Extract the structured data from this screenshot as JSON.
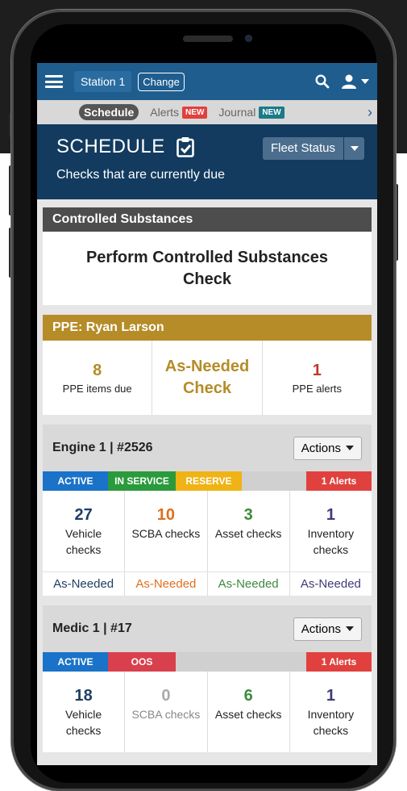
{
  "colors": {
    "nav_blue": "#1f5d8f",
    "hero_navy": "#123b5f",
    "ppe_gold": "#b58c28",
    "active_blue": "#1a73c9",
    "in_service_green": "#2a9a3c",
    "reserve_yellow": "#f0b316",
    "oos_red": "#d9404d",
    "alert_red": "#e0413e",
    "count_navy": "#1e3f66",
    "scba_orange": "#e06e1e",
    "asset_green": "#3c8a3c",
    "inventory_purple": "#3f3b7a",
    "zero_gray": "#aaaaaa"
  },
  "topbar": {
    "menu_icon": "hamburger-icon",
    "station": "Station 1",
    "change_label": "Change",
    "search_icon": "search-icon",
    "user_icon": "user-icon"
  },
  "tabs": {
    "schedule": "Schedule",
    "alerts": "Alerts",
    "alerts_badge": "NEW",
    "journal": "Journal",
    "journal_badge": "NEW"
  },
  "hero": {
    "title": "SCHEDULE",
    "icon": "clipboard-check-icon",
    "subtitle": "Checks that are currently due",
    "fleet_status": "Fleet Status"
  },
  "controlled": {
    "header": "Controlled Substances",
    "body_line1": "Perform Controlled Substances",
    "body_line2": "Check"
  },
  "ppe": {
    "header": "PPE: Ryan Larson",
    "items_due_num": "8",
    "items_due_label": "PPE items due",
    "as_needed_line1": "As-Needed",
    "as_needed_line2": "Check",
    "alerts_num": "1",
    "alerts_label": "PPE alerts"
  },
  "units": [
    {
      "name": "Engine 1 | #2526",
      "actions": "Actions",
      "statuses": [
        "ACTIVE",
        "IN SERVICE",
        "RESERVE"
      ],
      "alerts": "1 Alerts",
      "checks": [
        {
          "num": "27",
          "label1": "Vehicle",
          "label2": "checks",
          "asn": "As-Needed"
        },
        {
          "num": "10",
          "label1": "SCBA checks",
          "label2": "",
          "asn": "As-Needed"
        },
        {
          "num": "3",
          "label1": "Asset checks",
          "label2": "",
          "asn": "As-Needed"
        },
        {
          "num": "1",
          "label1": "Inventory",
          "label2": "checks",
          "asn": "As-Needed"
        }
      ]
    },
    {
      "name": "Medic 1 | #17",
      "actions": "Actions",
      "statuses": [
        "ACTIVE",
        "OOS"
      ],
      "alerts": "1 Alerts",
      "checks": [
        {
          "num": "18",
          "label1": "Vehicle",
          "label2": "checks"
        },
        {
          "num": "0",
          "label1": "SCBA checks",
          "label2": ""
        },
        {
          "num": "6",
          "label1": "Asset checks",
          "label2": ""
        },
        {
          "num": "1",
          "label1": "Inventory",
          "label2": "checks"
        }
      ]
    }
  ]
}
